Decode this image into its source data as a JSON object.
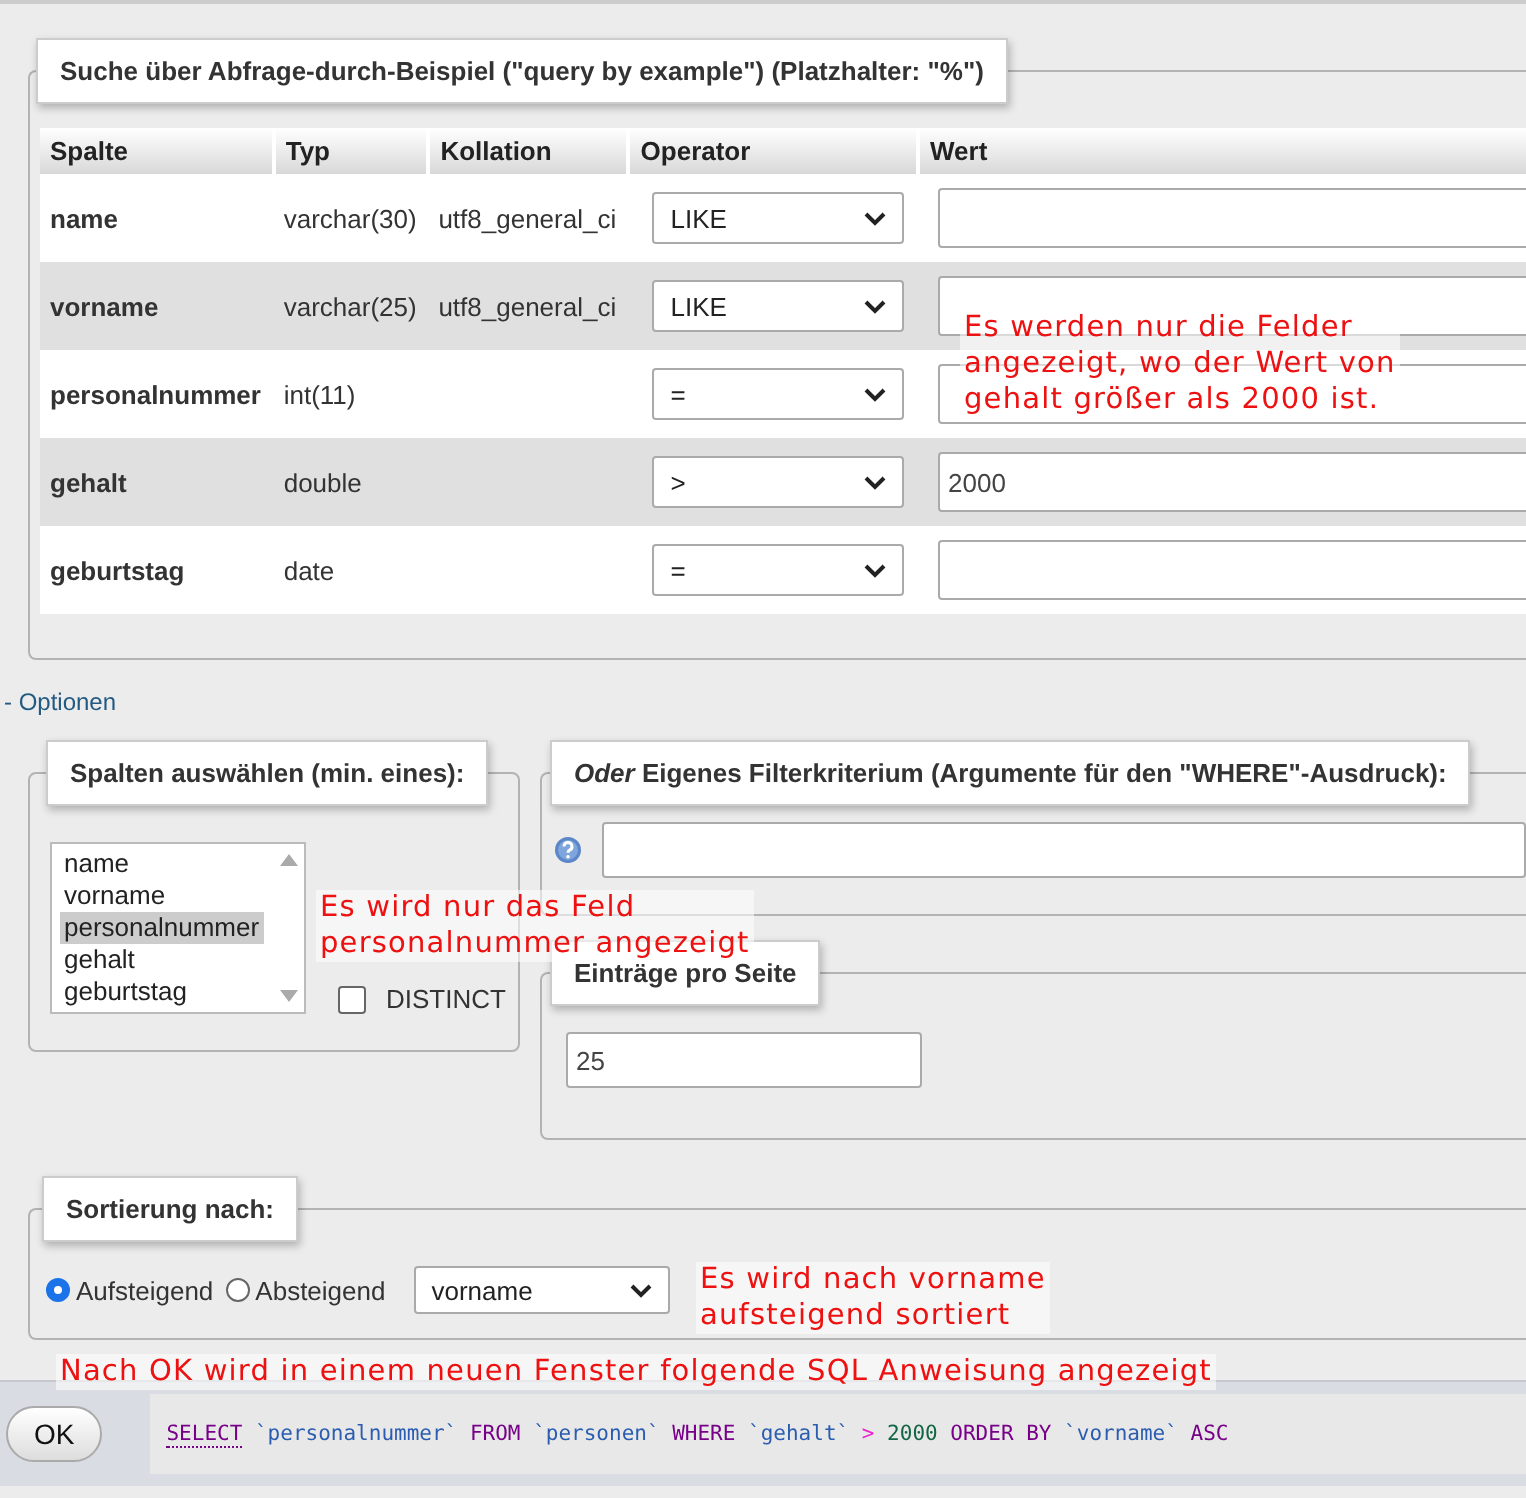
{
  "search_panel": {
    "legend": "Suche über Abfrage-durch-Beispiel (\"query by example\") (Platzhalter: \"%\")",
    "columns": [
      "Spalte",
      "Typ",
      "Kollation",
      "Operator",
      "Wert"
    ],
    "rows": [
      {
        "spalte": "name",
        "typ": "varchar(30)",
        "kollation": "utf8_general_ci",
        "operator": "LIKE"
      },
      {
        "spalte": "vorname",
        "typ": "varchar(25)",
        "kollation": "utf8_general_ci",
        "operator": "LIKE"
      },
      {
        "spalte": "personalnummer",
        "typ": "int(11)",
        "operator": "="
      },
      {
        "spalte": "gehalt",
        "typ": "double",
        "operator": ">",
        "wert": "2000"
      },
      {
        "spalte": "geburtstag",
        "typ": "date",
        "operator": "="
      }
    ]
  },
  "options_toggle": "- Optionen",
  "columns_panel": {
    "legend": "Spalten auswählen (min. eines):",
    "items": [
      {
        "label": "name",
        "selected": false
      },
      {
        "label": "vorname",
        "selected": false
      },
      {
        "label": "personalnummer",
        "selected": true
      },
      {
        "label": "gehalt",
        "selected": false
      },
      {
        "label": "geburtstag",
        "selected": false
      }
    ],
    "distinct": {
      "label": "DISTINCT",
      "checked": false
    }
  },
  "filter_panel": {
    "legend": "*Oder* Eigenes Filterkriterium (Argumente für den \"WHERE\"-Ausdruck):"
  },
  "entries_panel": {
    "legend": "Einträge pro Seite",
    "value": "25"
  },
  "sort_panel": {
    "legend": "Sortierung nach:",
    "radios": [
      {
        "label": "Aufsteigend",
        "selected": true
      },
      {
        "label": "Absteigend",
        "selected": false
      }
    ],
    "column": "vorname"
  },
  "annotations": [
    {
      "text": "Es werden nur die Felder\nangezeigt, wo der Wert von\ngehalt größer als 2000 ist."
    },
    {
      "text": "Es wird nur das Feld\npersonalnummer angezeigt"
    },
    {
      "text": "Es wird nach vorname\naufsteigend sortiert"
    },
    {
      "text": "Nach OK wird in einem neuen Fenster folgende SQL Anweisung angezeigt"
    }
  ],
  "ok_button": "OK",
  "sql": [
    {
      "kind": "keyword",
      "text": "SELECT"
    },
    {
      "kind": "identifier",
      "text": "`personalnummer`"
    },
    {
      "kind": "keyword",
      "text": "FROM"
    },
    {
      "kind": "identifier",
      "text": "`personen`"
    },
    {
      "kind": "keyword",
      "text": "WHERE"
    },
    {
      "kind": "identifier",
      "text": "`gehalt`"
    },
    {
      "kind": "operator",
      "text": ">"
    },
    {
      "kind": "number",
      "text": "2000"
    },
    {
      "kind": "keyword",
      "text": "ORDER BY"
    },
    {
      "kind": "identifier",
      "text": "`vorname`"
    },
    {
      "kind": "keyword",
      "text": "ASC"
    }
  ]
}
